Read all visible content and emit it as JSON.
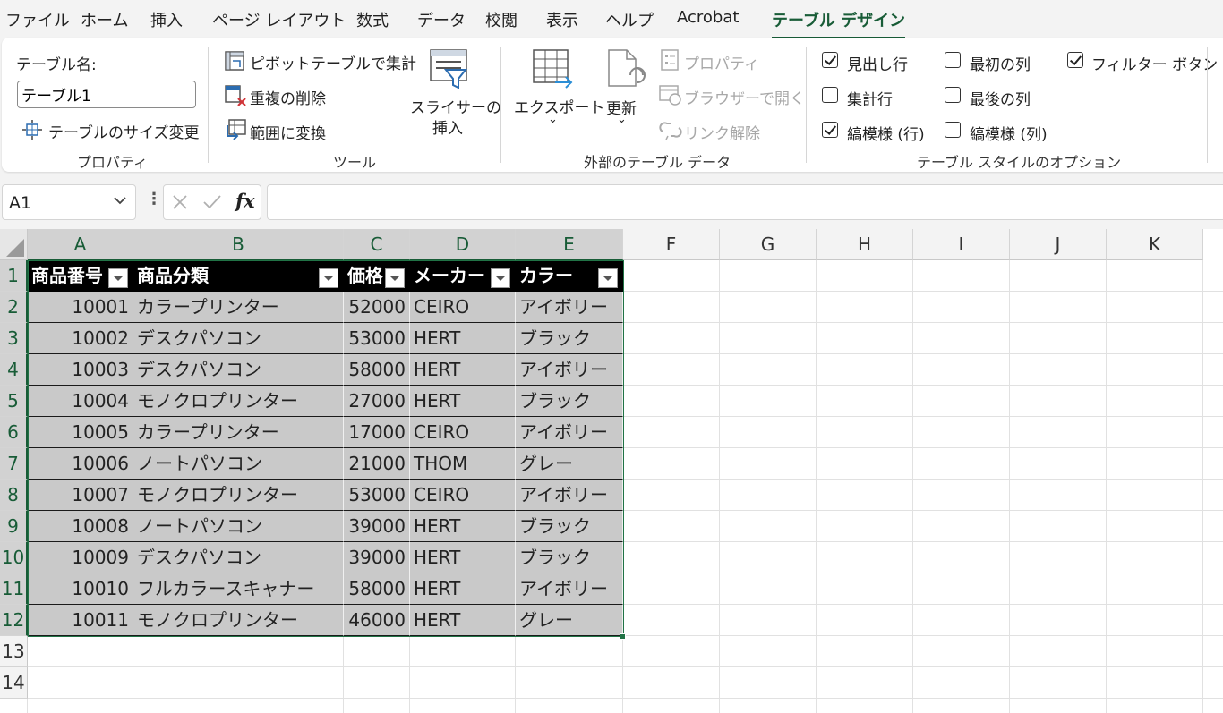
{
  "menu": {
    "tabs": [
      "ファイル",
      "ホーム",
      "挿入",
      "ページ レイアウト",
      "数式",
      "データ",
      "校閲",
      "表示",
      "ヘルプ",
      "Acrobat",
      "テーブル デザイン"
    ]
  },
  "ribbon": {
    "properties": {
      "name_label": "テーブル名:",
      "name_value": "テーブル1",
      "resize_label": "テーブルのサイズ変更",
      "group_label": "プロパティ"
    },
    "tools": {
      "pivot_label": "ピボットテーブルで集計",
      "dedupe_label": "重複の削除",
      "convert_label": "範囲に変換",
      "slicer_label_1": "スライサーの",
      "slicer_label_2": "挿入",
      "group_label": "ツール"
    },
    "external": {
      "export_label": "エクスポート",
      "refresh_label": "更新",
      "properties_label": "プロパティ",
      "browser_label": "ブラウザーで開く",
      "unlink_label": "リンク解除",
      "group_label": "外部のテーブル データ"
    },
    "style_options": {
      "header_row": {
        "label": "見出し行",
        "checked": true
      },
      "first_column": {
        "label": "最初の列",
        "checked": false
      },
      "filter_button": {
        "label": "フィルター ボタン",
        "checked": true
      },
      "total_row": {
        "label": "集計行",
        "checked": false
      },
      "last_column": {
        "label": "最後の列",
        "checked": false
      },
      "banded_rows": {
        "label": "縞模様 (行)",
        "checked": true
      },
      "banded_columns": {
        "label": "縞模様 (列)",
        "checked": false
      },
      "group_label": "テーブル スタイルのオプション"
    }
  },
  "formula_bar": {
    "name_box": "A1",
    "fx_label": "fx",
    "formula": ""
  },
  "grid": {
    "columns": [
      "A",
      "B",
      "C",
      "D",
      "E",
      "F",
      "G",
      "H",
      "I",
      "J",
      "K"
    ],
    "rows": [
      "1",
      "2",
      "3",
      "4",
      "5",
      "6",
      "7",
      "8",
      "9",
      "10",
      "11",
      "12",
      "13",
      "14"
    ],
    "table_headers": [
      "商品番号",
      "商品分類",
      "価格",
      "メーカー",
      "カラー"
    ],
    "table_rows": [
      [
        "10001",
        "カラープリンター",
        "52000",
        "CEIRO",
        "アイボリー"
      ],
      [
        "10002",
        "デスクパソコン",
        "53000",
        "HERT",
        "ブラック"
      ],
      [
        "10003",
        "デスクパソコン",
        "58000",
        "HERT",
        "アイボリー"
      ],
      [
        "10004",
        "モノクロプリンター",
        "27000",
        "HERT",
        "ブラック"
      ],
      [
        "10005",
        "カラープリンター",
        "17000",
        "CEIRO",
        "アイボリー"
      ],
      [
        "10006",
        "ノートパソコン",
        "21000",
        "THOM",
        "グレー"
      ],
      [
        "10007",
        "モノクロプリンター",
        "53000",
        "CEIRO",
        "アイボリー"
      ],
      [
        "10008",
        "ノートパソコン",
        "39000",
        "HERT",
        "ブラック"
      ],
      [
        "10009",
        "デスクパソコン",
        "39000",
        "HERT",
        "ブラック"
      ],
      [
        "10010",
        "フルカラースキャナー",
        "58000",
        "HERT",
        "アイボリー"
      ],
      [
        "10011",
        "モノクロプリンター",
        "46000",
        "HERT",
        "グレー"
      ]
    ]
  },
  "colors": {
    "accent": "#185c37",
    "table_border": "#217346",
    "header_fill": "#000000",
    "body_fill": "#c9c9c9"
  }
}
